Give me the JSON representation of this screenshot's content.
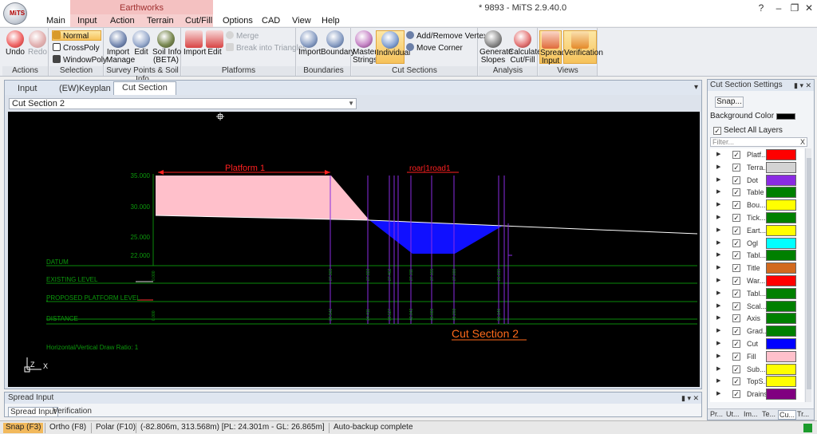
{
  "app": {
    "window_title": "* 9893 - MiTS 2.9.40.0",
    "logo_text": "MiTS",
    "contextual_tab_group": "Earthworks",
    "window_controls": [
      "?",
      "–",
      "❐",
      "✕"
    ]
  },
  "ribbon_tabs": [
    "Main",
    "Input",
    "Action",
    "Terrain",
    "Cut/Fill",
    "Options",
    "CAD",
    "View",
    "Help"
  ],
  "ribbon": {
    "actions": {
      "label": "Actions",
      "undo": "Undo",
      "redo": "Redo"
    },
    "selection": {
      "label": "Selection",
      "normal": "Normal",
      "crosspoly": "CrossPoly",
      "windowpoly": "WindowPoly"
    },
    "survey": {
      "label": "Survey Points & Soil Info",
      "import_manage": "Import\nManage",
      "edit": "Edit",
      "soil_info": "Soil Info\n(BETA)"
    },
    "platforms": {
      "label": "Platforms",
      "import": "Import",
      "edit": "Edit",
      "merge": "Merge",
      "break": "Break into Triangles"
    },
    "boundaries": {
      "label": "Boundaries",
      "import": "Import",
      "boundary": "Boundary"
    },
    "cut_sections": {
      "label": "Cut Sections",
      "master_strings": "Master\nStrings",
      "individual": "Individual",
      "add_remove_vertex": "Add/Remove Vertex",
      "move_corner": "Move Corner"
    },
    "analysis": {
      "label": "Analysis",
      "generate_slopes": "Generate\nSlopes",
      "calculate_cut_fill": "Calculate\nCut/Fill"
    },
    "views": {
      "label": "Views",
      "spread_input": "Spread\nInput",
      "verification": "Verification"
    }
  },
  "doc": {
    "tabs": [
      "Input",
      "(EW)Keyplan",
      "Cut Section"
    ],
    "active_tab": "Cut Section",
    "selected_section": "Cut Section 2"
  },
  "drawing": {
    "platform_label": "Platform 1",
    "road_label": "roar|1road1",
    "section_title": "Cut Section 2",
    "ratio_text": "Horizontal/Vertical Draw Ratio: 1",
    "y_ticks": [
      "35.000",
      "30.000",
      "25.000",
      "22.000"
    ],
    "rows": [
      "DATUM",
      "EXISTING LEVEL",
      "PROPOSED PLATFORM LEVEL",
      "DISTANCE"
    ],
    "axis_x": "X",
    "axis_z": "Z",
    "colors": {
      "platform_fill": "#ffc0cb",
      "cut_fill": "#0000ff",
      "terrain": "#ffffff",
      "grid": "#008000",
      "vertical": "#8a2be2",
      "title": "#ff6600"
    }
  },
  "cut_section_settings": {
    "title": "Cut Section Settings",
    "snap": "Snap...",
    "background_color_label": "Background Color",
    "select_all": "Select All Layers",
    "filter_placeholder": "Filter...",
    "layers": [
      {
        "name": "Platf...",
        "color": "#ff0000"
      },
      {
        "name": "Terra...",
        "color": "#d3d3d3"
      },
      {
        "name": "Dot",
        "color": "#8a2be2"
      },
      {
        "name": "Table",
        "color": "#008000"
      },
      {
        "name": "Bou...",
        "color": "#ffff00"
      },
      {
        "name": "Tick...",
        "color": "#008000"
      },
      {
        "name": "Eart...",
        "color": "#ffff00"
      },
      {
        "name": "Ogl",
        "color": "#00ffff"
      },
      {
        "name": "Tabl...",
        "color": "#008000"
      },
      {
        "name": "Title",
        "color": "#d2691e"
      },
      {
        "name": "War...",
        "color": "#ff0000"
      },
      {
        "name": "Tabl...",
        "color": "#008000"
      },
      {
        "name": "Scal...",
        "color": "#008000"
      },
      {
        "name": "Axis",
        "color": "#008000"
      },
      {
        "name": "Grad...",
        "color": "#008000"
      },
      {
        "name": "Cut",
        "color": "#0000ff"
      },
      {
        "name": "Fill",
        "color": "#ffc0cb"
      },
      {
        "name": "Sub...",
        "color": "#ffff00"
      },
      {
        "name": "TopS...",
        "color": "#ffff00"
      },
      {
        "name": "Drains",
        "color": "#800080"
      }
    ],
    "bottom_tabs": [
      "Pr...",
      "Ut...",
      "Im...",
      "Te...",
      "Cu...",
      "Tr..."
    ],
    "active_bottom_tab": "Cu..."
  },
  "spread_input_panel": {
    "title": "Spread Input",
    "tabs": [
      "Spread Input",
      "Verification"
    ],
    "active_tab": "Spread Input"
  },
  "statusbar": {
    "snap": "Snap (F3)",
    "ortho": "Ortho (F8)",
    "polar": "Polar (F10)",
    "coords": "(-82.806m, 313.568m) [PL: 24.301m - GL: 26.865m]",
    "message": "Auto-backup complete"
  }
}
